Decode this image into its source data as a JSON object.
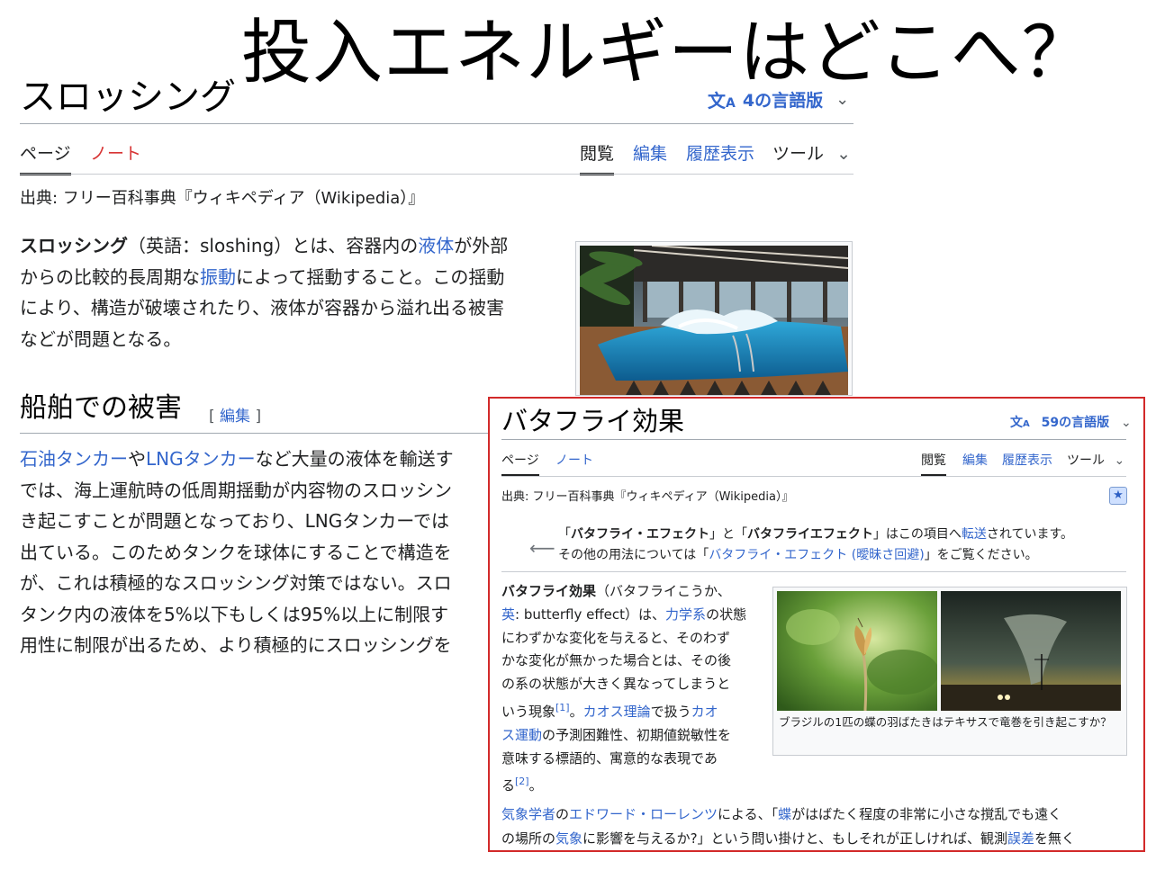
{
  "slide_title": "投入エネルギーはどこへ？",
  "article1": {
    "title": "スロッシング",
    "languages": "4の言語版",
    "tabs": {
      "page": "ページ",
      "talk": "ノート",
      "read": "閲覧",
      "edit": "編集",
      "history": "履歴表示",
      "tools": "ツール"
    },
    "source": "出典: フリー百科事典『ウィキペディア（Wikipedia）』",
    "intro": {
      "term": "スロッシング",
      "t1": "（英語：sloshing）とは、容器内の",
      "link1": "液体",
      "t2": "が外部",
      "t3": "からの比較的長周期な",
      "link2": "振動",
      "t4": "によって揺動すること。この揺動",
      "t5": "により、構造が破壊されたり、液体が容器から溢れ出る被害",
      "t6": "などが問題となる。"
    },
    "section_title": "船舶での被害",
    "section_edit": "編集",
    "body": {
      "link1": "石油タンカー",
      "t1": "や",
      "link2": "LNGタンカー",
      "t2": "など大量の液体を輸送す",
      "l2": "では、海上運航時の低周期揺動が内容物のスロッシン",
      "l3": "き起こすことが問題となっており、LNGタンカーでは",
      "l4": "出ている。このためタンクを球体にすることで構造を",
      "l5": "が、これは積極的なスロッシング対策ではない。スロ",
      "l6": "タンク内の液体を5%以下もしくは95%以上に制限す",
      "l7": "用性に制限が出るため、より積極的にスロッシングを"
    }
  },
  "article2": {
    "title": "バタフライ効果",
    "languages": "59の言語版",
    "tabs": {
      "page": "ページ",
      "talk": "ノート",
      "read": "閲覧",
      "edit": "編集",
      "history": "履歴表示",
      "tools": "ツール"
    },
    "source": "出典: フリー百科事典『ウィキペディア（Wikipedia）』",
    "hatnote": {
      "q1": "「",
      "b1": "バタフライ・エフェクト",
      "q2": "」と「",
      "b2": "バタフライエフェクト",
      "q3": "」はこの項目へ",
      "link": "転送",
      "q4": "されています。",
      "line2a": "その他の用法については「",
      "line2link": "バタフライ・エフェクト (曖昧さ回避)",
      "line2b": "」をご覧ください。"
    },
    "intro": {
      "term": "バタフライ効果",
      "t1": "（バタフライこうか、",
      "link_en": "英",
      "t2": ": butterfly effect）は、",
      "link_mech": "力学系",
      "t3": "の状態",
      "l3": "にわずかな変化を与えると、そのわず",
      "l4": "かな変化が無かった場合とは、その後",
      "l5": "の系の状態が大きく異なってしまうと",
      "l6a": "いう現象",
      "ref1": "[1]",
      "l6b": "。",
      "link_chaos": "カオス理論",
      "l6c": "で扱う",
      "link_cm1": "カオ",
      "link_cm2": "ス運動",
      "l7": "の予測困難性、初期値鋭敏性を",
      "l8": "意味する標語的、寓意的な表現であ",
      "l9a": "る",
      "ref2": "[2]",
      "l9b": "。"
    },
    "caption": "ブラジルの1匹の蝶の羽ばたきはテキサスで竜巻を引き起こすか？",
    "para2": {
      "link1": "気象学者",
      "t1": "の",
      "link2": "エドワード・ローレンツ",
      "t2": "による、「",
      "link3": "蝶",
      "t3": "がはばたく程度の非常に小さな撹乱でも遠く",
      "t4": "の場所の",
      "link4": "気象",
      "t5": "に影響を与えるか?」という問い掛けと、もしそれが正しければ、観測",
      "link5": "誤差",
      "t6": "を無く"
    }
  },
  "colors": {
    "link": "#3366cc",
    "frame": "#d22a2a",
    "redlink": "#d73333"
  },
  "icons": [
    "translate-icon",
    "chevron-down-icon",
    "star-icon",
    "disambig-icon"
  ]
}
